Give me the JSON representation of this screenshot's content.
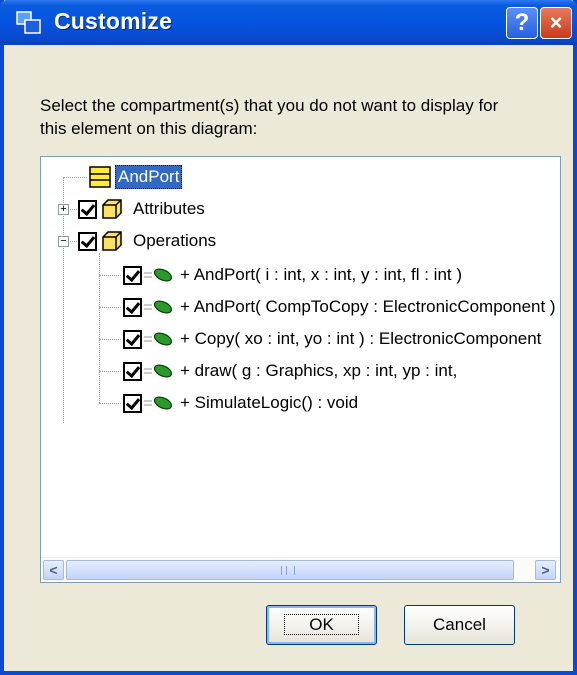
{
  "window": {
    "title": "Customize",
    "help_label": "?",
    "close_label": "×"
  },
  "prompt": "Select the compartment(s) that you do not want to display for this element on this diagram:",
  "tree": {
    "root_label": "AndPort",
    "attributes_label": "Attributes",
    "operations_label": "Operations",
    "expand_label": "+",
    "collapse_label": "−",
    "operations": [
      "+ AndPort( i : int,  x : int,  y : int,  fl : int )",
      "+ AndPort( CompToCopy : ElectronicComponent )",
      "+ Copy( xo : int,  yo : int ) : ElectronicComponent",
      "+ draw( g : Graphics,  xp : int,  yp : int,  ",
      "+ SimulateLogic() : void"
    ]
  },
  "scrollbar": {
    "left_arrow": "<",
    "right_arrow": ">"
  },
  "buttons": {
    "ok": "OK",
    "cancel": "Cancel"
  },
  "colors": {
    "title_bar": "#0554e3",
    "dialog_bg": "#ece9d8",
    "selection": "#316ac5",
    "class_icon": "#ffeb3b",
    "operation_icon": "#1f8f1f"
  }
}
